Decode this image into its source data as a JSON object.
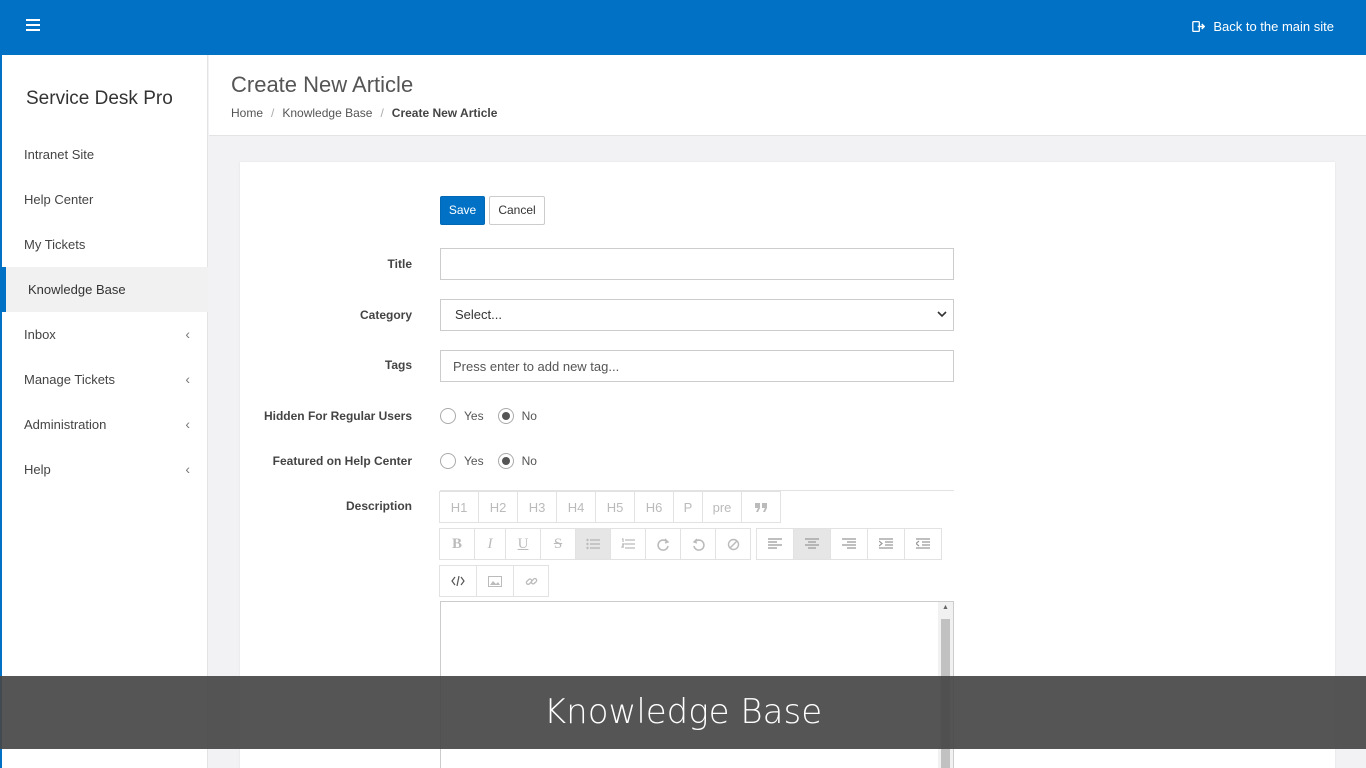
{
  "topbar": {
    "back_label": "Back to the main site"
  },
  "sidebar": {
    "brand": "Service Desk Pro",
    "items": [
      {
        "label": "Intranet Site",
        "has_children": false
      },
      {
        "label": "Help Center",
        "has_children": false
      },
      {
        "label": "My Tickets",
        "has_children": false
      },
      {
        "label": "Knowledge Base",
        "has_children": false,
        "active": true
      },
      {
        "label": "Inbox",
        "has_children": true
      },
      {
        "label": "Manage Tickets",
        "has_children": true
      },
      {
        "label": "Administration",
        "has_children": true
      },
      {
        "label": "Help",
        "has_children": true
      }
    ],
    "chevron": "‹"
  },
  "header": {
    "title": "Create New Article",
    "breadcrumb": [
      "Home",
      "Knowledge Base",
      "Create New Article"
    ],
    "separator": "/"
  },
  "form": {
    "save_label": "Save",
    "cancel_label": "Cancel",
    "title_label": "Title",
    "title_value": "",
    "category_label": "Category",
    "category_value": "Select...",
    "tags_label": "Tags",
    "tags_placeholder": "Press enter to add new tag...",
    "hidden_label": "Hidden For Regular Users",
    "featured_label": "Featured on Help Center",
    "yes_label": "Yes",
    "no_label": "No",
    "hidden_value": "No",
    "featured_value": "No",
    "description_label": "Description"
  },
  "editor_toolbar": {
    "row1": [
      "H1",
      "H2",
      "H3",
      "H4",
      "H5",
      "H6",
      "P",
      "pre",
      "quote-icon"
    ],
    "row2": [
      "bold-icon",
      "italic-icon",
      "underline-icon",
      "strikethrough-icon",
      "bullet-list-icon",
      "numbered-list-icon",
      "redo-icon",
      "undo-icon",
      "clear-format-icon",
      "align-left-icon",
      "align-center-icon",
      "align-right-icon",
      "indent-icon",
      "outdent-icon"
    ],
    "row3": [
      "code-icon",
      "image-icon",
      "link-icon"
    ]
  },
  "overlay_caption": "Knowledge Base",
  "colors": {
    "brand_blue": "#0071c5",
    "overlay": "#464646"
  }
}
